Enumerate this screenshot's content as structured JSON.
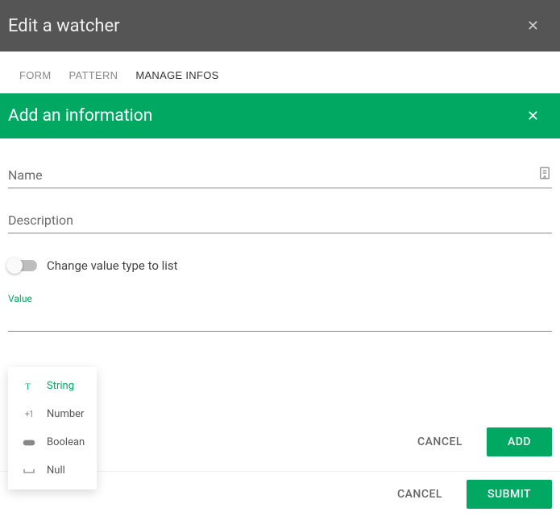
{
  "outer_modal": {
    "title": "Edit a watcher",
    "tabs": [
      {
        "label": "FORM"
      },
      {
        "label": "PATTERN"
      },
      {
        "label": "MANAGE INFOS"
      }
    ],
    "actions": {
      "cancel_label": "CANCEL",
      "submit_label": "SUBMIT"
    }
  },
  "inner_modal": {
    "title": "Add an information",
    "fields": {
      "name_placeholder": "Name",
      "description_placeholder": "Description",
      "toggle_label": "Change value type to list",
      "value_label": "Value"
    },
    "type_options": [
      {
        "key": "string",
        "label": "String",
        "icon": "T"
      },
      {
        "key": "number",
        "label": "Number",
        "icon": "+1"
      },
      {
        "key": "boolean",
        "label": "Boolean",
        "icon": "pill"
      },
      {
        "key": "null",
        "label": "Null",
        "icon": "␣"
      }
    ],
    "selected_type": "string",
    "actions": {
      "cancel_label": "CANCEL",
      "add_label": "ADD"
    }
  },
  "colors": {
    "primary": "#00a862",
    "header_dark": "#555555"
  }
}
